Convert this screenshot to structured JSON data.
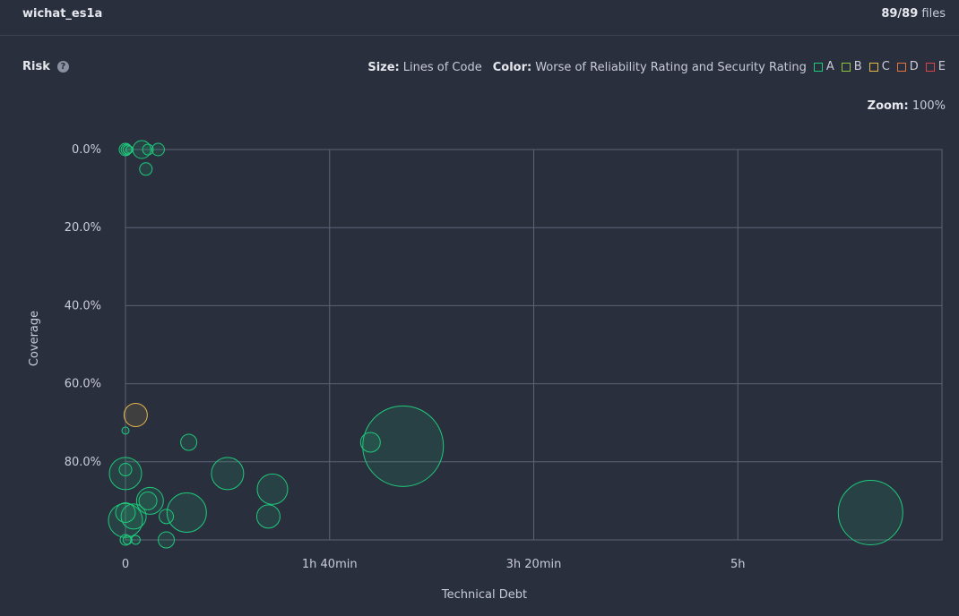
{
  "header": {
    "project_name": "wichat_es1a",
    "files_count": "89/89",
    "files_label": "files"
  },
  "toolbar": {
    "title": "Risk",
    "help_glyph": "?",
    "size_label": "Size:",
    "size_value": "Lines of Code",
    "color_label": "Color:",
    "color_value": "Worse of Reliability Rating and Security Rating",
    "ratings": [
      {
        "label": "A",
        "color": "#1ec97a"
      },
      {
        "label": "B",
        "color": "#8fc53b"
      },
      {
        "label": "C",
        "color": "#e5b94a"
      },
      {
        "label": "D",
        "color": "#e8743b"
      },
      {
        "label": "E",
        "color": "#e0414b"
      }
    ],
    "zoom_label": "Zoom:",
    "zoom_value": "100%"
  },
  "chart_data": {
    "type": "scatter",
    "xlabel": "Technical Debt",
    "ylabel": "Coverage",
    "x_unit": "minutes",
    "xlim": [
      0,
      400
    ],
    "ylim": [
      0,
      100
    ],
    "y_inverted": true,
    "x_ticks": [
      {
        "value": 0,
        "label": "0"
      },
      {
        "value": 100,
        "label": "1h 40min"
      },
      {
        "value": 200,
        "label": "3h 20min"
      },
      {
        "value": 300,
        "label": "5h"
      }
    ],
    "y_ticks": [
      {
        "value": 0,
        "label": "0.0%"
      },
      {
        "value": 20,
        "label": "20.0%"
      },
      {
        "value": 40,
        "label": "40.0%"
      },
      {
        "value": 60,
        "label": "60.0%"
      },
      {
        "value": 80,
        "label": "80.0%"
      }
    ],
    "grid": true,
    "size_note": "bubble size = lines of code",
    "points": [
      {
        "x": 0,
        "y": 0,
        "r": 7,
        "rating": "A"
      },
      {
        "x": 0.5,
        "y": 0,
        "r": 6,
        "rating": "A"
      },
      {
        "x": 1,
        "y": 0,
        "r": 5,
        "rating": "A"
      },
      {
        "x": 2,
        "y": 0,
        "r": 4,
        "rating": "A"
      },
      {
        "x": 8,
        "y": 0,
        "r": 10,
        "rating": "A"
      },
      {
        "x": 11,
        "y": 0,
        "r": 6,
        "rating": "A"
      },
      {
        "x": 16,
        "y": 0,
        "r": 7,
        "rating": "A"
      },
      {
        "x": 10,
        "y": 5,
        "r": 7,
        "rating": "A"
      },
      {
        "x": 5,
        "y": 68,
        "r": 13,
        "rating": "C"
      },
      {
        "x": 0,
        "y": 72,
        "r": 4,
        "rating": "A"
      },
      {
        "x": 31,
        "y": 75,
        "r": 9,
        "rating": "A"
      },
      {
        "x": 120,
        "y": 75,
        "r": 11,
        "rating": "A"
      },
      {
        "x": 136,
        "y": 76,
        "r": 45,
        "rating": "A"
      },
      {
        "x": 0,
        "y": 82,
        "r": 7,
        "rating": "A"
      },
      {
        "x": 0,
        "y": 83,
        "r": 18,
        "rating": "A"
      },
      {
        "x": 50,
        "y": 83,
        "r": 18,
        "rating": "A"
      },
      {
        "x": 72,
        "y": 87,
        "r": 17,
        "rating": "A"
      },
      {
        "x": 12,
        "y": 90,
        "r": 15,
        "rating": "A"
      },
      {
        "x": 11,
        "y": 90,
        "r": 10,
        "rating": "A"
      },
      {
        "x": 30,
        "y": 93,
        "r": 22,
        "rating": "A"
      },
      {
        "x": 0,
        "y": 93,
        "r": 11,
        "rating": "A"
      },
      {
        "x": 0,
        "y": 95,
        "r": 19,
        "rating": "A"
      },
      {
        "x": 4,
        "y": 94,
        "r": 14,
        "rating": "A"
      },
      {
        "x": 20,
        "y": 94,
        "r": 8,
        "rating": "A"
      },
      {
        "x": 70,
        "y": 94,
        "r": 13,
        "rating": "A"
      },
      {
        "x": 365,
        "y": 93,
        "r": 36,
        "rating": "A"
      },
      {
        "x": 0,
        "y": 100,
        "r": 6,
        "rating": "A"
      },
      {
        "x": 1,
        "y": 100,
        "r": 5,
        "rating": "A"
      },
      {
        "x": 5,
        "y": 100,
        "r": 5,
        "rating": "A"
      },
      {
        "x": 20,
        "y": 100,
        "r": 9,
        "rating": "A"
      }
    ]
  }
}
